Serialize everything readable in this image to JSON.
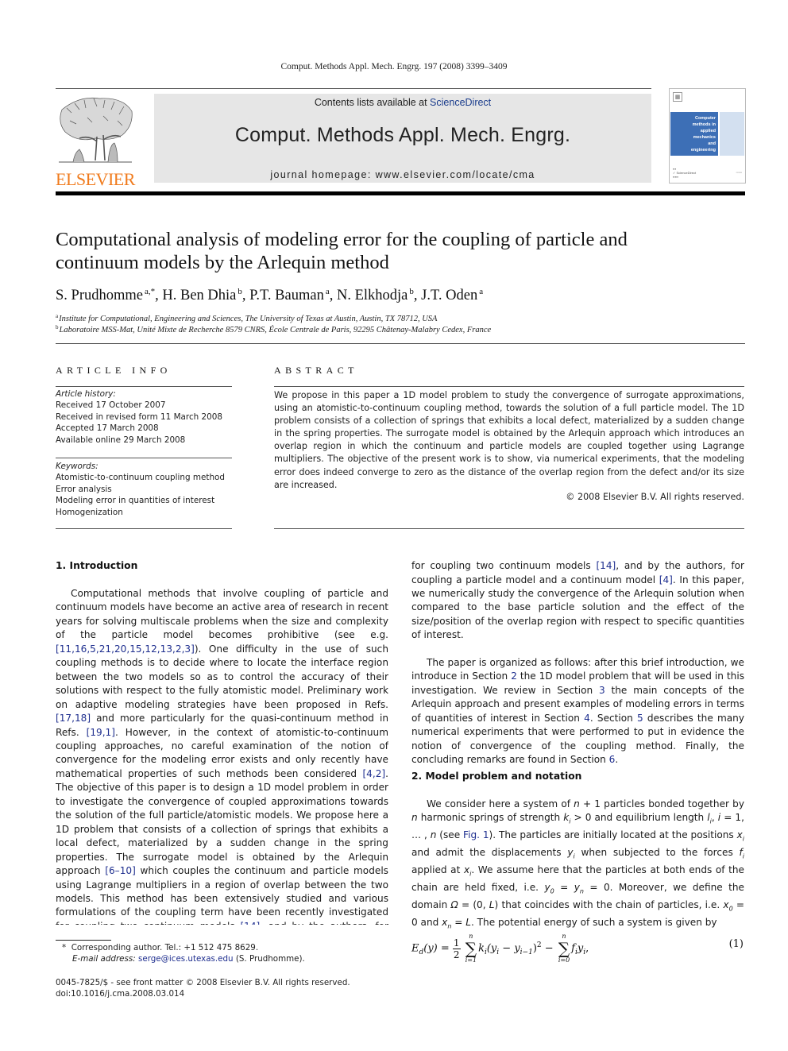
{
  "header": {
    "citation": "Comput. Methods Appl. Mech. Engrg. 197 (2008) 3399–3409",
    "contents_prefix": "Contents lists available at ",
    "contents_link": "ScienceDirect",
    "journal_name": "Comput. Methods Appl. Mech. Engrg.",
    "homepage": "journal homepage: www.elsevier.com/locate/cma",
    "publisher_logo_text": "ELSEVIER",
    "cover": {
      "lines": [
        "Computer",
        "methods in",
        "applied",
        "mechanics",
        "and",
        "engineering"
      ],
      "brand_color": "#3d6fb6"
    },
    "logo_color": "#f07b1d"
  },
  "article": {
    "title": "Computational analysis of modeling error for the coupling of particle and continuum models by the Arlequin method",
    "authors": [
      {
        "name": "S. Prudhomme",
        "aff": "a,*"
      },
      {
        "name": "H. Ben Dhia",
        "aff": "b"
      },
      {
        "name": "P.T. Bauman",
        "aff": "a"
      },
      {
        "name": "N. Elkhodja",
        "aff": "b"
      },
      {
        "name": "J.T. Oden",
        "aff": "a"
      }
    ],
    "affiliations": [
      {
        "mark": "a",
        "text": "Institute for Computational, Engineering and Sciences, The University of Texas at Austin, Austin, TX 78712, USA"
      },
      {
        "mark": "b",
        "text": "Laboratoire MSS-Mat, Unité Mixte de Recherche 8579 CNRS, École Centrale de Paris, 92295 Châtenay-Malabry Cedex, France"
      }
    ]
  },
  "article_info": {
    "heading": "ARTICLE INFO",
    "history_label": "Article history:",
    "history": [
      "Received 17 October 2007",
      "Received in revised form 11 March 2008",
      "Accepted 17 March 2008",
      "Available online 29 March 2008"
    ],
    "keywords_label": "Keywords:",
    "keywords": [
      "Atomistic-to-continuum coupling method",
      "Error analysis",
      "Modeling error in quantities of interest",
      "Homogenization"
    ]
  },
  "abstract": {
    "heading": "ABSTRACT",
    "text": "We propose in this paper a 1D model problem to study the convergence of surrogate approximations, using an atomistic-to-continuum coupling method, towards the solution of a full particle model. The 1D problem consists of a collection of springs that exhibits a local defect, materialized by a sudden change in the spring properties. The surrogate model is obtained by the Arlequin approach which introduces an overlap region in which the continuum and particle models are coupled together using Lagrange multipliers. The objective of the present work is to show, via numerical experiments, that the modeling error does indeed converge to zero as the distance of the overlap region from the defect and/or its size are increased.",
    "copyright": "© 2008 Elsevier B.V. All rights reserved."
  },
  "sections": {
    "intro": {
      "heading": "1.  Introduction",
      "p1": [
        {
          "t": "Computational methods that involve coupling of particle and continuum models have become an active area of research in recent years for solving multiscale problems when the size and complexity of the particle model becomes prohibitive (see e.g. "
        },
        {
          "r": "[11,16,5,21,20,15,12,13,2,3]"
        },
        {
          "t": "). One difficulty in the use of such coupling methods is to decide where to locate the interface region between the two models so as to control the accuracy of their solutions with respect to the fully atomistic model. Preliminary work on adaptive modeling strategies have been proposed in Refs. "
        },
        {
          "r": "[17,18]"
        },
        {
          "t": " and more particularly for the quasi-continuum method in Refs. "
        },
        {
          "r": "[19,1]"
        },
        {
          "t": ". However, in the context of atomistic-to-continuum coupling approaches, no careful examination of the notion of convergence for the modeling error exists and only recently have mathematical properties of such methods been considered "
        },
        {
          "r": "[4,2]"
        },
        {
          "t": ". The objective of this paper is to design a 1D model problem in order to investigate the convergence of coupled approximations towards the solution of the full particle/atomistic models. We propose here a 1D problem that consists of a collection of springs that exhibits a local defect, materialized by a sudden change in the spring properties. The surrogate model is obtained by the Arlequin approach "
        },
        {
          "r": "[6–10]"
        },
        {
          "t": " which couples the continuum and particle models using Lagrange multipliers in a region of overlap between the two models. This method has been extensively studied and various formulations of the coupling term have been recently investigated for coupling two continuum models "
        },
        {
          "r": "[14]"
        },
        {
          "t": ", and by the authors, for coupling a particle model and a continuum model "
        },
        {
          "r": "[4]"
        },
        {
          "t": ". In this paper, we numerically study the convergence of the Arlequin solution when compared to the base particle solution and the effect of the size/position of the overlap region with respect to specific quantities of interest."
        }
      ],
      "p2": [
        {
          "t": "The paper is organized as follows: after this brief introduction, we introduce in Section "
        },
        {
          "r": "2"
        },
        {
          "t": " the 1D model problem that will be used in this investigation. We review in Section "
        },
        {
          "r": "3"
        },
        {
          "t": " the main concepts of the Arlequin approach and present examples of modeling errors in terms of quantities of interest in Section "
        },
        {
          "r": "4"
        },
        {
          "t": ". Section "
        },
        {
          "r": "5"
        },
        {
          "t": " describes the many numerical experiments that were performed to put in evidence the notion of convergence of the coupling method. Finally, the concluding remarks are found in Section "
        },
        {
          "r": "6"
        },
        {
          "t": "."
        }
      ]
    },
    "model": {
      "heading": "2.  Model problem and notation",
      "p1": [
        {
          "t": "We consider here a system of "
        },
        {
          "m": "n"
        },
        {
          "t": " + 1 particles bonded together by "
        },
        {
          "m": "n"
        },
        {
          "t": " harmonic springs of strength "
        },
        {
          "m": "k"
        },
        {
          "sub": "i"
        },
        {
          "t": " > 0 and equilibrium length "
        },
        {
          "m": "l"
        },
        {
          "sub": "i"
        },
        {
          "t": ", "
        },
        {
          "m": "i"
        },
        {
          "t": " = 1, … , "
        },
        {
          "m": "n"
        },
        {
          "t": " (see "
        },
        {
          "r": "Fig. 1"
        },
        {
          "t": "). The particles are initially located at the positions "
        },
        {
          "m": "x"
        },
        {
          "sub": "i"
        },
        {
          "t": " and admit the displacements "
        },
        {
          "m": "y"
        },
        {
          "sub": "i"
        },
        {
          "t": " when subjected to the forces "
        },
        {
          "m": "f"
        },
        {
          "sub": "i"
        },
        {
          "t": " applied at "
        },
        {
          "m": "x"
        },
        {
          "sub": "i"
        },
        {
          "t": ". We assume here that the particles at both ends of the chain are held fixed, i.e. "
        },
        {
          "m": "y"
        },
        {
          "sub": "0"
        },
        {
          "t": " = "
        },
        {
          "m": "y"
        },
        {
          "sub": "n"
        },
        {
          "t": " = 0. Moreover, we define the domain "
        },
        {
          "m": "Ω"
        },
        {
          "t": " = (0, "
        },
        {
          "m": "L"
        },
        {
          "t": ") that coincides with the chain of particles, i.e. "
        },
        {
          "m": "x"
        },
        {
          "sub": "0"
        },
        {
          "t": " = 0 and "
        },
        {
          "m": "x"
        },
        {
          "sub": "n"
        },
        {
          "t": " = "
        },
        {
          "m": "L"
        },
        {
          "t": ". The potential energy of such a system is given by"
        }
      ]
    }
  },
  "equation": {
    "lhs": "E",
    "lhs_sub": "d",
    "lhs_arg": "(y) =",
    "frac_num": "1",
    "frac_den": "2",
    "sum1_top": "n",
    "sum1_bot": "i=1",
    "term1": "k",
    "term1_sub": "i",
    "term1_rest": "(y",
    "term1_sub2": "i",
    "term1_minus": " − y",
    "term1_sub3": "i−1",
    "term1_close": ")",
    "term1_pow": "2",
    "minus": " −",
    "sum2_top": "n",
    "sum2_bot": "i=0",
    "term2": "f",
    "term2_sub": "i",
    "term2_y": "y",
    "term2_sub2": "i",
    "term2_end": ",",
    "number": "(1)"
  },
  "footnotes": {
    "star": "*",
    "corresponding": "Corresponding author. Tel.: +1 512 475 8629.",
    "email_label": "E-mail address:",
    "email": "serge@ices.utexas.edu",
    "email_suffix": " (S. Prudhomme).",
    "issn": "0045-7825/$ - see front matter © 2008 Elsevier B.V. All rights reserved.",
    "doi": "doi:10.1016/j.cma.2008.03.014"
  },
  "colors": {
    "link": "#1f2f8f",
    "banner_bg": "#e6e6e6",
    "elsevier_orange": "#f07b1d"
  }
}
